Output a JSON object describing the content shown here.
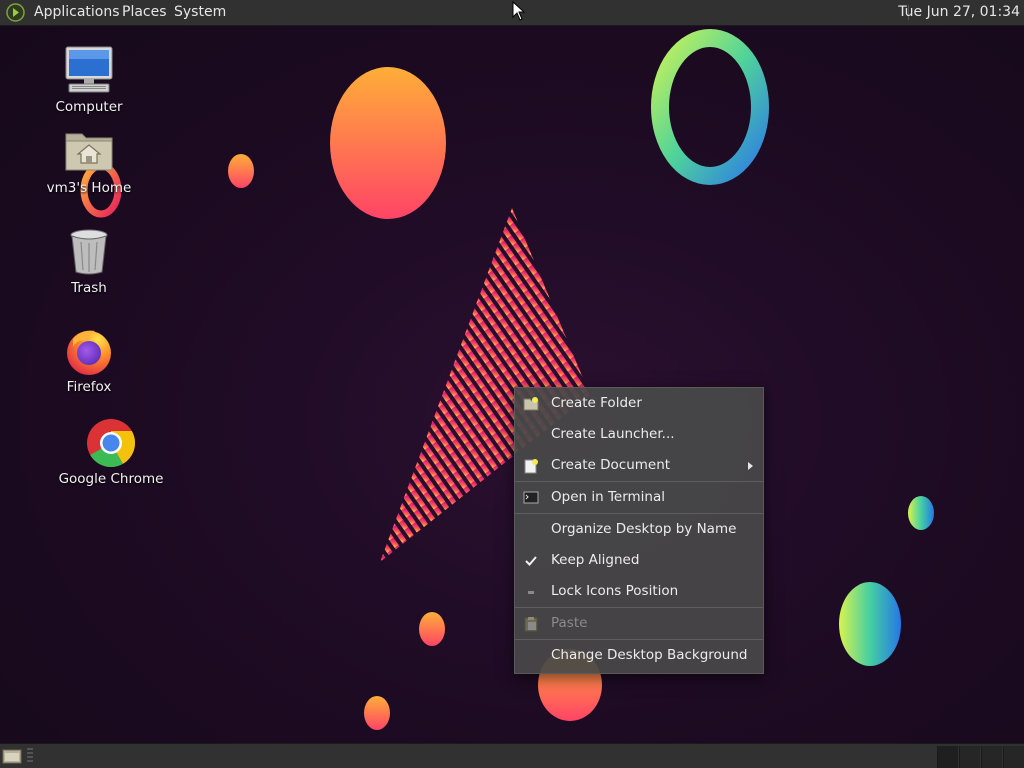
{
  "top_panel": {
    "menus": [
      "Applications",
      "Places",
      "System"
    ],
    "clock": "Tue Jun 27, 01:34",
    "menu_icon": "mate-logo-icon"
  },
  "desktop_icons": [
    {
      "label": "Computer",
      "icon": "computer-icon"
    },
    {
      "label": "vm3's Home",
      "icon": "home-folder-icon"
    },
    {
      "label": "Trash",
      "icon": "trash-icon"
    },
    {
      "label": "Firefox",
      "icon": "firefox-icon"
    },
    {
      "label": "Google Chrome",
      "icon": "chrome-icon"
    }
  ],
  "context_menu": {
    "items": [
      {
        "label": "Create Folder",
        "icon": "new-folder-icon"
      },
      {
        "label": "Create Launcher...",
        "icon": ""
      },
      {
        "label": "Create Document",
        "icon": "new-document-icon",
        "submenu": true
      },
      {
        "label": "Open in Terminal",
        "icon": "terminal-icon"
      },
      {
        "label": "Organize Desktop by Name",
        "icon": ""
      },
      {
        "label": "Keep Aligned",
        "icon": "check-icon",
        "checked": true
      },
      {
        "label": "Lock Icons Position",
        "icon": "unchecked-icon",
        "checked": false
      },
      {
        "label": "Paste",
        "icon": "paste-icon",
        "disabled": true
      },
      {
        "label": "Change Desktop Background",
        "icon": ""
      }
    ]
  },
  "bottom_panel": {
    "show_desktop_icon": "show-desktop-icon",
    "workspaces": 4
  },
  "colors": {
    "panel": "#313131",
    "menu_bg": "#484848",
    "wallpaper_bg": "#1e0b24"
  }
}
